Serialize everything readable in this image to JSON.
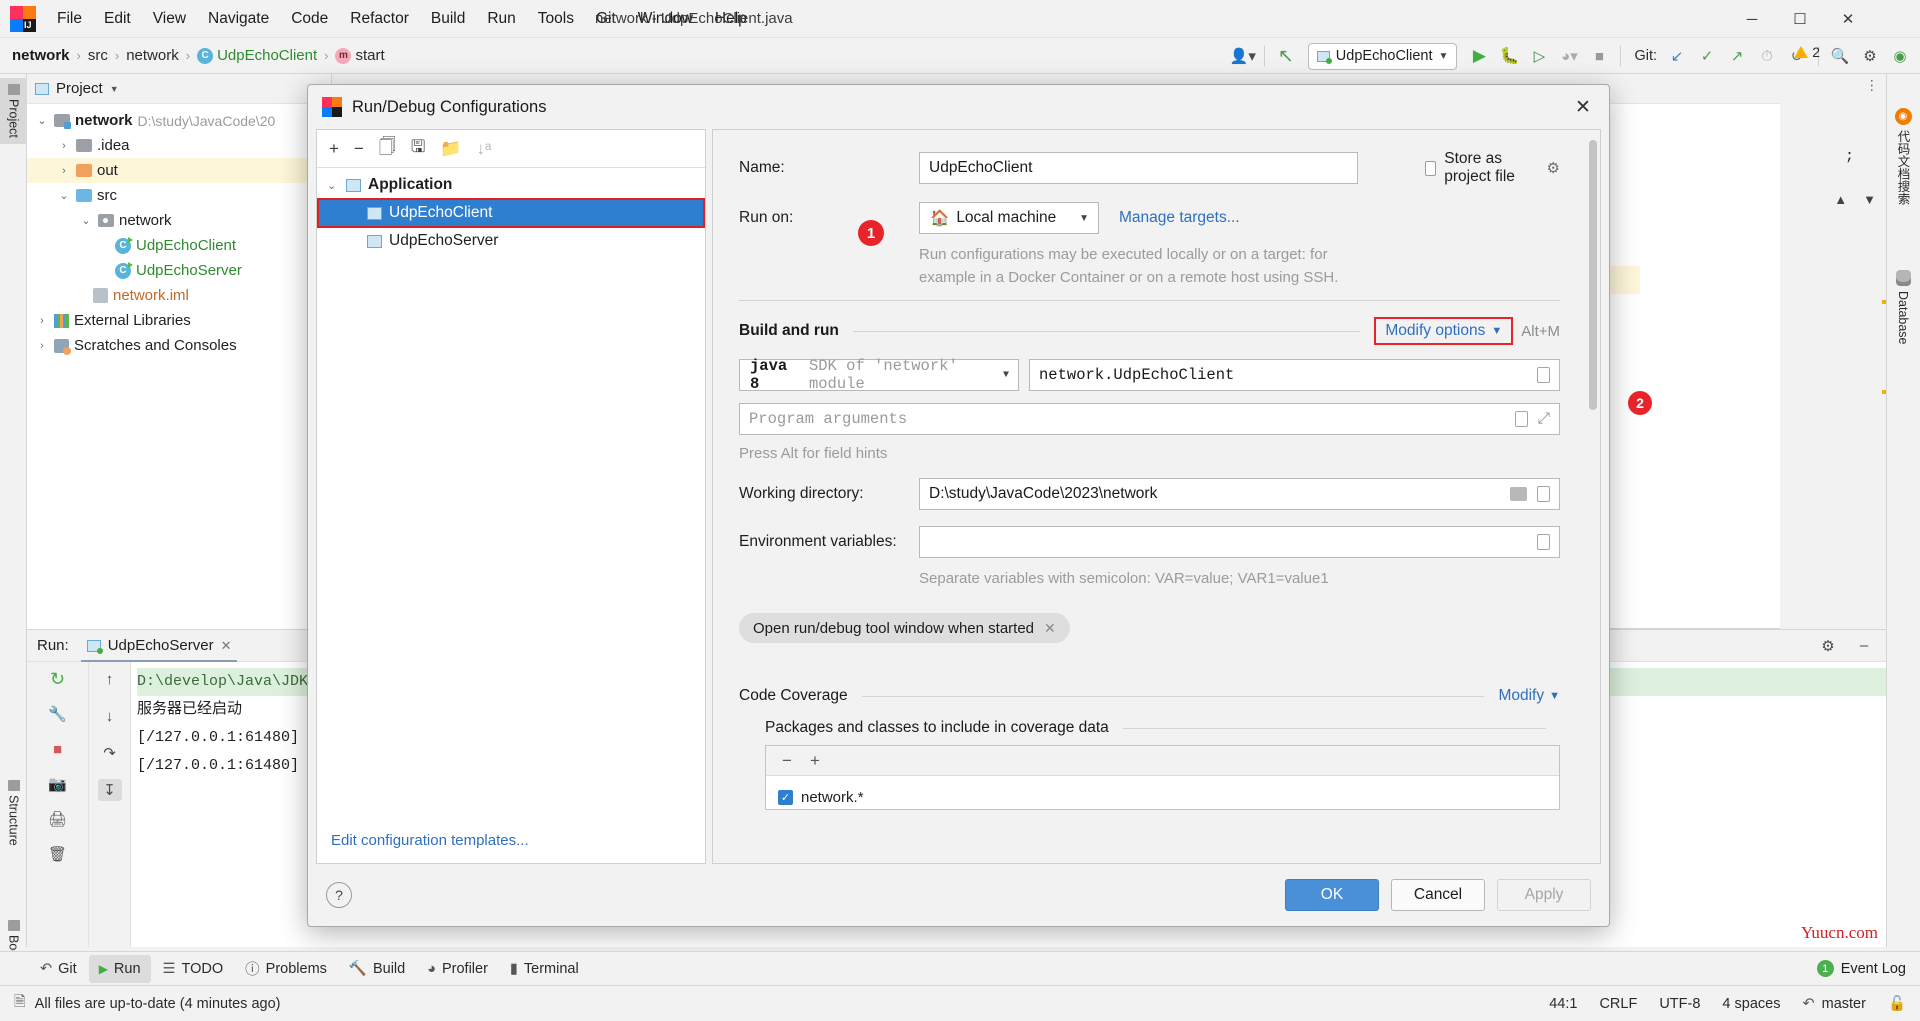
{
  "window": {
    "title": "network - UdpEchoClient.java",
    "menu": [
      "File",
      "Edit",
      "View",
      "Navigate",
      "Code",
      "Refactor",
      "Build",
      "Run",
      "Tools",
      "Git",
      "Window",
      "Help"
    ],
    "controls": {
      "minimize": "─",
      "maximize": "☐",
      "close": "✕"
    }
  },
  "navbar": {
    "breadcrumb": [
      {
        "label": "network",
        "style": "bold"
      },
      {
        "label": "src",
        "style": "plain"
      },
      {
        "label": "network",
        "style": "plain"
      },
      {
        "label": "UdpEchoClient",
        "style": "green",
        "icon": "class-icon"
      },
      {
        "label": "start",
        "style": "plain",
        "icon": "method-icon"
      }
    ],
    "separator": "›",
    "run_config": "UdpEchoClient",
    "git_label": "Git:",
    "icons": [
      "user-avatar-icon",
      "updates-icon",
      "run-icon",
      "debug-icon",
      "run-coverage-icon",
      "profile-icon",
      "stop-icon",
      "git-update-icon",
      "git-commit-icon",
      "git-push-icon",
      "git-history-icon",
      "git-rollback-icon",
      "search-icon",
      "settings-icon",
      "ide-assistant-icon"
    ]
  },
  "left_strip": {
    "tabs": [
      "Project",
      "Structure",
      "Bookmarks"
    ]
  },
  "right_strip": {
    "tabs": [
      "代码文档搜索",
      "Database"
    ]
  },
  "project_panel": {
    "header": "Project",
    "tree": [
      {
        "level": 0,
        "arrow": "⌄",
        "icon": "module-folder-icon",
        "label": "network",
        "style": "bold",
        "suffix": "D:\\study\\JavaCode\\20"
      },
      {
        "level": 1,
        "arrow": "›",
        "icon": "folder-icon",
        "label": ".idea",
        "style": "plain",
        "suffix": ""
      },
      {
        "level": 1,
        "arrow": "›",
        "icon": "out-folder-icon",
        "label": "out",
        "style": "plain",
        "suffix": "",
        "highlight": true
      },
      {
        "level": 1,
        "arrow": "⌄",
        "icon": "source-folder-icon",
        "label": "src",
        "style": "plain",
        "suffix": ""
      },
      {
        "level": 2,
        "arrow": "⌄",
        "icon": "package-icon",
        "label": "network",
        "style": "plain",
        "suffix": ""
      },
      {
        "level": 3,
        "arrow": "",
        "icon": "java-class-icon",
        "label": "UdpEchoClient",
        "style": "green",
        "suffix": ""
      },
      {
        "level": 3,
        "arrow": "",
        "icon": "java-class-icon",
        "label": "UdpEchoServer",
        "style": "green",
        "suffix": ""
      },
      {
        "level": 2,
        "arrow": "",
        "icon": "iml-file-icon",
        "label": "network.iml",
        "style": "orange",
        "suffix": ""
      },
      {
        "level": 0,
        "arrow": "›",
        "icon": "libraries-icon",
        "label": "External Libraries",
        "style": "plain",
        "suffix": ""
      },
      {
        "level": 0,
        "arrow": "›",
        "icon": "scratches-icon",
        "label": "Scratches and Consoles",
        "style": "plain",
        "suffix": ""
      }
    ]
  },
  "editor": {
    "warning_count": "2",
    "code_hint": ";"
  },
  "run_window": {
    "label": "Run:",
    "tab": "UdpEchoServer",
    "close": "✕",
    "console_lines": [
      "D:\\develop\\Java\\JDK",
      "服务器已经启动",
      "[/127.0.0.1:61480] ",
      "[/127.0.0.1:61480] "
    ],
    "side_icons": [
      "rerun-icon",
      "wrench-icon",
      "stop-icon",
      "camera-icon",
      "up-icon",
      "down-icon",
      "soft-wrap-icon",
      "scroll-end-icon",
      "print-icon",
      "trash-icon"
    ],
    "header_right_icons": [
      "settings-icon",
      "hide-icon"
    ]
  },
  "dialog": {
    "title": "Run/Debug Configurations",
    "close": "✕",
    "toolbar_icons": [
      "add-icon",
      "remove-icon",
      "copy-icon",
      "save-icon",
      "folder-add-icon",
      "sort-alpha-icon"
    ],
    "tree": {
      "group": "Application",
      "group_arrow": "⌄",
      "items": [
        "UdpEchoClient",
        "UdpEchoServer"
      ],
      "selected": "UdpEchoClient"
    },
    "edit_templates": "Edit configuration templates...",
    "annotations": [
      {
        "number": "1",
        "target": "configuration-list"
      },
      {
        "number": "2",
        "target": "modify-options-button"
      }
    ],
    "fields": {
      "name_label": "Name:",
      "name_value": "UdpEchoClient",
      "store_as_project_file": "Store as project file",
      "run_on_label": "Run on:",
      "run_on_value": "Local machine",
      "manage_targets": "Manage targets...",
      "run_on_hint_line1": "Run configurations may be executed locally or on a target: for",
      "run_on_hint_line2": "example in a Docker Container or on a remote host using SSH.",
      "build_and_run": "Build and run",
      "modify_options": "Modify options",
      "modify_options_shortcut": "Alt+M",
      "jre_bold": "java 8",
      "jre_rest": "SDK of 'network' module",
      "main_class": "network.UdpEchoClient",
      "program_arguments_placeholder": "Program arguments",
      "field_hints": "Press Alt for field hints",
      "working_directory_label": "Working directory:",
      "working_directory_value": "D:\\study\\JavaCode\\2023\\network",
      "environment_variables_label": "Environment variables:",
      "environment_variables_value": "",
      "env_hint": "Separate variables with semicolon: VAR=value; VAR1=value1",
      "chip_label": "Open run/debug tool window when started",
      "chip_close": "✕",
      "code_coverage": "Code Coverage",
      "code_coverage_modify": "Modify",
      "coverage_packages_title": "Packages and classes to include in coverage data",
      "coverage_items": [
        {
          "label": "network.*",
          "checked": true
        }
      ]
    },
    "footer": {
      "help": "?",
      "ok": "OK",
      "cancel": "Cancel",
      "apply": "Apply"
    }
  },
  "bottom_tabs": {
    "items": [
      {
        "label": "Git",
        "icon": "git-icon",
        "active": false
      },
      {
        "label": "Run",
        "icon": "run-icon",
        "active": true
      },
      {
        "label": "TODO",
        "icon": "todo-icon",
        "active": false
      },
      {
        "label": "Problems",
        "icon": "problems-icon",
        "active": false
      },
      {
        "label": "Build",
        "icon": "build-icon",
        "active": false
      },
      {
        "label": "Profiler",
        "icon": "profiler-icon",
        "active": false
      },
      {
        "label": "Terminal",
        "icon": "terminal-icon",
        "active": false
      }
    ],
    "event_log": "Event Log",
    "event_count": "1"
  },
  "status_bar": {
    "message": "All files are up-to-date (4 minutes ago)",
    "caret": "44:1",
    "line_separator": "CRLF",
    "encoding": "UTF-8",
    "indent": "4 spaces",
    "branch": "master",
    "lock": "🔓"
  },
  "watermark": "Yuucn.com",
  "colors": {
    "accent": "#2f7fd0",
    "annotation_red": "#e8242a",
    "link": "#2f6fbf",
    "green": "#2e8b2e"
  }
}
